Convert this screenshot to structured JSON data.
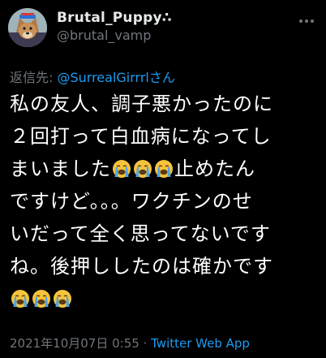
{
  "user": {
    "display_name": "Brutal_Puppy",
    "display_name_suffix": "∴",
    "handle": "@brutal_vamp"
  },
  "reply": {
    "prefix": "返信先: ",
    "mention": "@SurrealGirrrl",
    "suffix": "さん"
  },
  "tweet": {
    "line1": "私の友人、調子悪かったのに",
    "line2": "２回打って白血病になってし",
    "line3_pre": "まいました",
    "line3_post": "止めたん",
    "line4": "ですけど。。。ワクチンのせ",
    "line5": "いだって全く思ってないです",
    "line6": "ね。後押ししたのは確かです",
    "emoji_name": "loudly-crying-face"
  },
  "meta": {
    "timestamp": "2021年10月07日 0:55",
    "separator": " · ",
    "source": "Twitter Web App"
  },
  "colors": {
    "background": "#000000",
    "text": "#ffffff",
    "secondary": "#71767b",
    "link": "#1d9bf0"
  }
}
